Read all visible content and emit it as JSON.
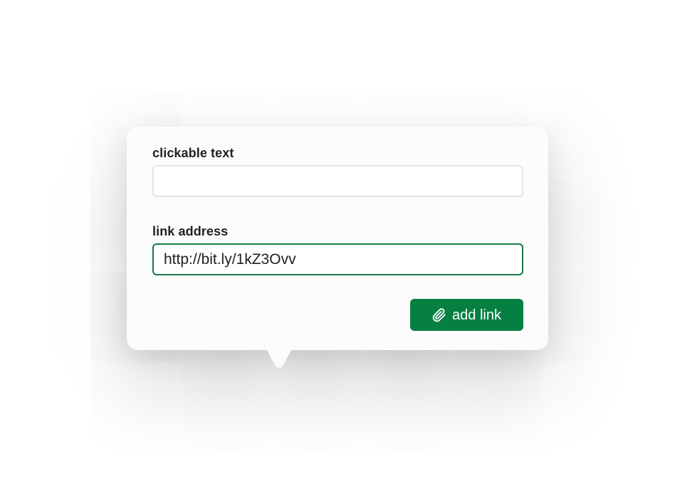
{
  "popover": {
    "clickable_text": {
      "label": "clickable text",
      "value": ""
    },
    "link_address": {
      "label": "link address",
      "value": "http://bit.ly/1kZ3Ovv"
    },
    "add_button": {
      "label": "add link",
      "icon": "paperclip-icon"
    }
  },
  "colors": {
    "accent": "#067f43",
    "focus_border": "#137a44",
    "input_border": "#e3e3e3",
    "popover_bg": "#fcfcfc",
    "label_text": "#222222"
  }
}
